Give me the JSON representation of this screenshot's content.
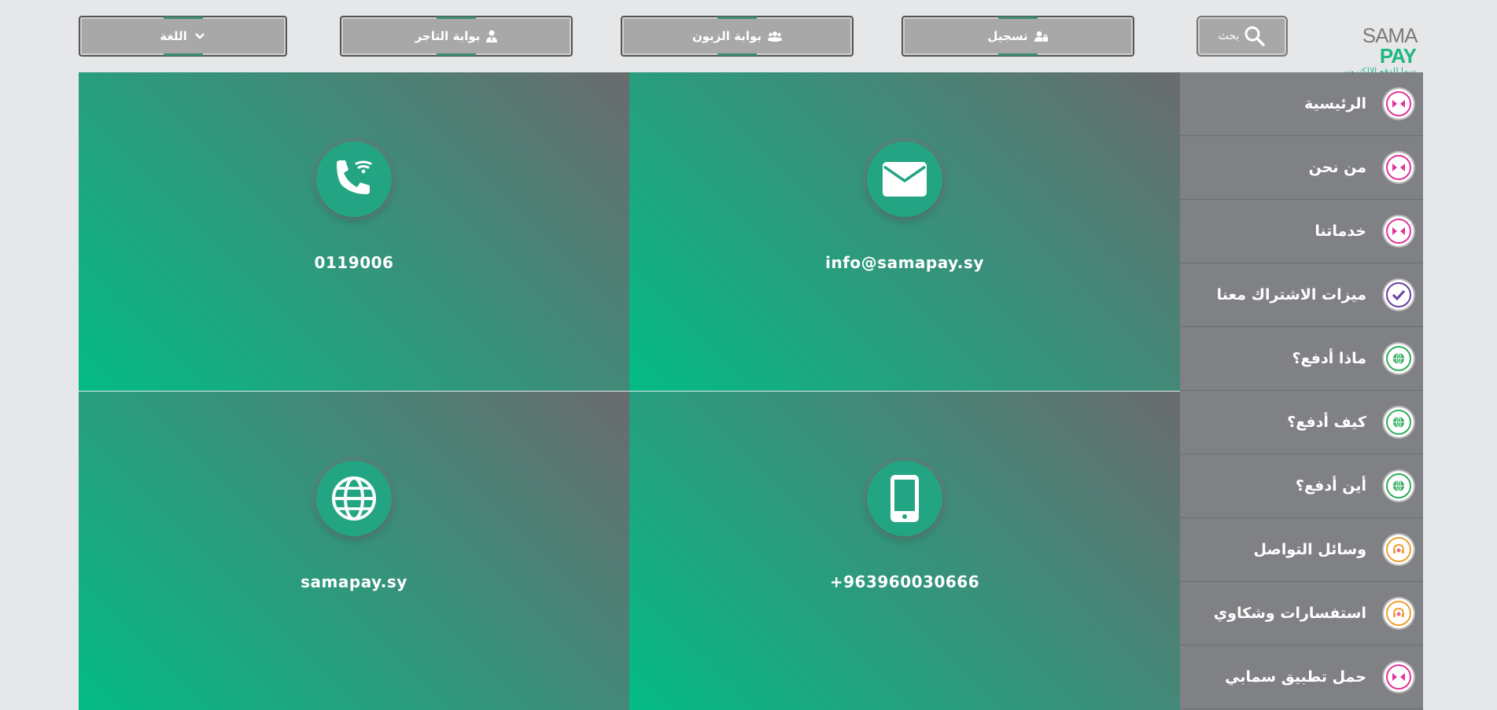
{
  "header": {
    "logo": {
      "brand_a": "SAMA",
      "brand_b": "PAY",
      "tagline": "سما للدفع الالكتروني"
    },
    "search_label": "بحث",
    "register_label": "تسجيل",
    "customer_portal_label": "بوابة الزبون",
    "merchant_portal_label": "بوابة التاجر",
    "language_label": "اللغة"
  },
  "contacts": {
    "email": "info@samapay.sy",
    "phone": "0119006",
    "mobile": "+963960030666",
    "website": "samapay.sy"
  },
  "sidebar": {
    "items": [
      {
        "label": "الرئيسية",
        "icon": "arrows-icon",
        "color": "#e0359a"
      },
      {
        "label": "من نحن",
        "icon": "arrows-icon",
        "color": "#e0359a"
      },
      {
        "label": "خدماتنا",
        "icon": "arrows-icon",
        "color": "#e0359a"
      },
      {
        "label": "ميزات الاشتراك معنا",
        "icon": "check-icon",
        "color": "#6a3fa0"
      },
      {
        "label": "ماذا أدفع؟",
        "icon": "globe-icon",
        "color": "#2fae5c"
      },
      {
        "label": "كيف أدفع؟",
        "icon": "globe-icon",
        "color": "#2fae5c"
      },
      {
        "label": "أين أدفع؟",
        "icon": "globe-icon",
        "color": "#2fae5c"
      },
      {
        "label": "وسائل التواصل",
        "icon": "headset-icon",
        "color": "#f0a030"
      },
      {
        "label": "استفسارات وشكاوي",
        "icon": "headset-icon",
        "color": "#f0a030"
      },
      {
        "label": "حمل تطبيق سمابي",
        "icon": "arrows-icon",
        "color": "#e0359a"
      }
    ]
  },
  "colors": {
    "accent": "#1fb784",
    "card_dark": "#6b6b6e",
    "card_light": "#04bb86",
    "sidebar": "#808184"
  }
}
